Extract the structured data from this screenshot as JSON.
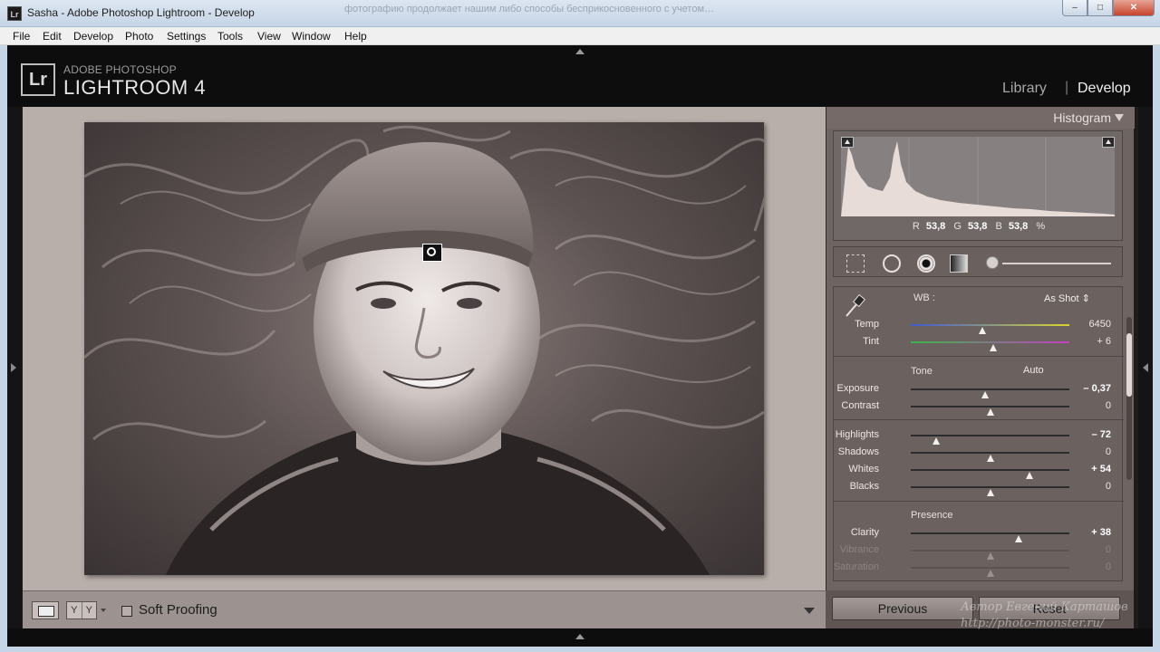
{
  "window": {
    "title": "Sasha - Adobe Photoshop Lightroom - Develop",
    "app_icon": "Lr",
    "background_text": "фотографию продолжает нашим либо способы бесприкосновенного с учетом…",
    "controls": {
      "minimize": "–",
      "maximize": "□",
      "close": "✕"
    }
  },
  "menu": [
    "File",
    "Edit",
    "Develop",
    "Photo",
    "Settings",
    "Tools",
    "View",
    "Window",
    "Help"
  ],
  "identity": {
    "logo": "Lr",
    "brand_top": "ADOBE PHOTOSHOP",
    "brand_main": "LIGHTROOM 4",
    "modules": {
      "library": "Library",
      "separator": "|",
      "develop": "Develop"
    }
  },
  "toolbar": {
    "soft_proofing": "Soft Proofing",
    "compare_icon": [
      "Y",
      "Y"
    ]
  },
  "histogram": {
    "title": "Histogram",
    "r_label": "R",
    "r_value": "53,8",
    "g_label": "G",
    "g_value": "53,8",
    "b_label": "B",
    "b_value": "53,8",
    "percent": "%"
  },
  "basic": {
    "wb_label": "WB :",
    "wb_value": "As Shot",
    "wb_arrow": "⇕",
    "tone_label": "Tone",
    "auto_label": "Auto",
    "presence_label": "Presence",
    "sliders": {
      "temp": {
        "label": "Temp",
        "value": "6450",
        "position": 0.45
      },
      "tint": {
        "label": "Tint",
        "value": "+ 6",
        "position": 0.52
      },
      "exposure": {
        "label": "Exposure",
        "value": "– 0,37",
        "position": 0.47
      },
      "contrast": {
        "label": "Contrast",
        "value": "0",
        "position": 0.5
      },
      "highlights": {
        "label": "Highlights",
        "value": "– 72",
        "position": 0.16
      },
      "shadows": {
        "label": "Shadows",
        "value": "0",
        "position": 0.5
      },
      "whites": {
        "label": "Whites",
        "value": "+ 54",
        "position": 0.75
      },
      "blacks": {
        "label": "Blacks",
        "value": "0",
        "position": 0.5
      },
      "clarity": {
        "label": "Clarity",
        "value": "+ 38",
        "position": 0.68
      },
      "vibrance": {
        "label": "Vibrance",
        "value": "0",
        "position": 0.5
      },
      "saturation": {
        "label": "Saturation",
        "value": "0",
        "position": 0.5
      }
    }
  },
  "buttons": {
    "previous": "Previous",
    "reset": "Reset"
  },
  "watermark": {
    "line1": "Автор Евгений Карташов",
    "line2": "http://photo-monster.ru/"
  },
  "colors": {
    "canvas_bg": "#b8aeaa",
    "panel_bg": "#6e6462",
    "active_module": "#f0f0f0"
  }
}
